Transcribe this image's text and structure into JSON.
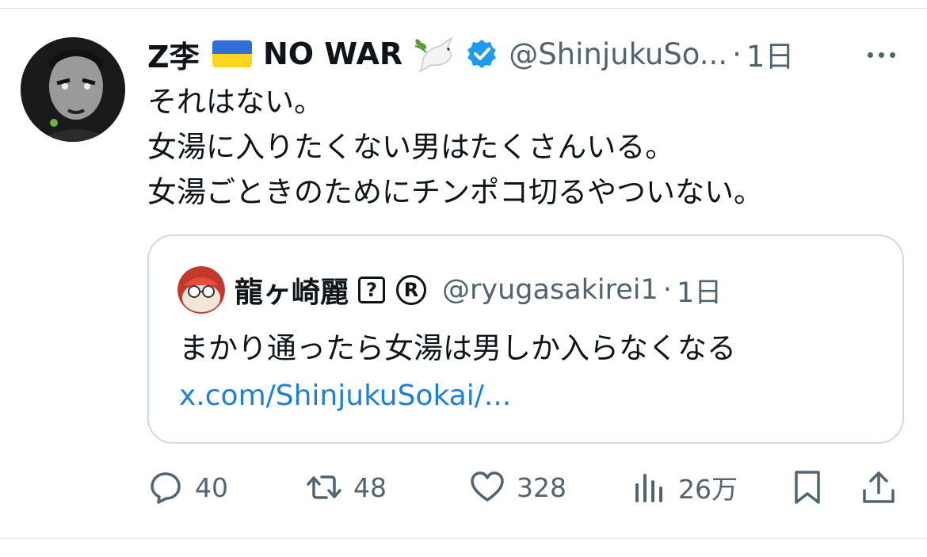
{
  "tweet": {
    "author": {
      "name_part1": "Z李",
      "name_part2": "NO WAR",
      "handle": "@ShinjukuSo...",
      "time_sep": "·",
      "time": "1日"
    },
    "body_lines": [
      "それはない。",
      "女湯に入りたくない男はたくさんいる。",
      "女湯ごときのためにチンポコ切るやついない。"
    ],
    "quote": {
      "author_name": "龍ヶ崎麗",
      "badge1": "?",
      "badge2": "R",
      "handle": "@ryugasakirei1",
      "time_sep": "·",
      "time": "1日",
      "text": "まかり通ったら女湯は男しか入らなくなる",
      "link": "x.com/ShinjukuSokai/..."
    },
    "actions": {
      "replies": "40",
      "reposts": "48",
      "likes": "328",
      "views": "26万"
    }
  },
  "colors": {
    "text": "#0f1419",
    "muted": "#536471",
    "link": "#1d7fd8",
    "verified": "#1d9bf0",
    "border": "#cfd9de"
  }
}
